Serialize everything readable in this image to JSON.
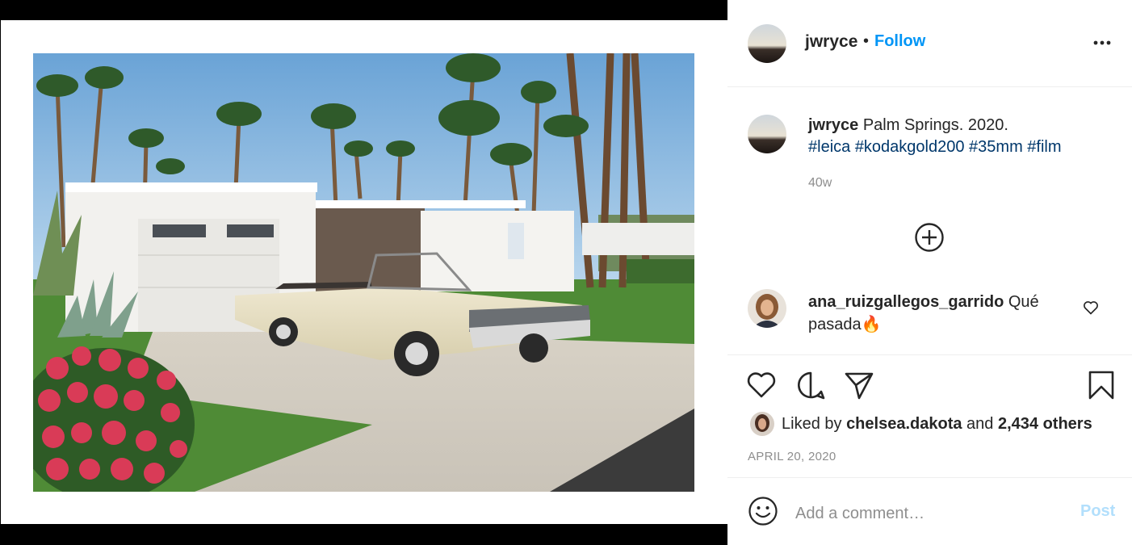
{
  "post": {
    "username": "jwryce",
    "follow_separator": "•",
    "follow_label": "Follow",
    "more_icon": "more-horizontal-icon"
  },
  "caption": {
    "username": "jwryce",
    "text": "Palm Springs. 2020.",
    "hashtags": "#leica #kodakgold200 #35mm #film",
    "age": "40w",
    "load_more_icon": "plus-circle-icon"
  },
  "comments": [
    {
      "username": "ana_ruizgallegos_garrido",
      "text": "Qué pasada",
      "emoji": "🔥",
      "like_icon": "heart-outline-icon"
    }
  ],
  "actions": {
    "like_icon": "heart-outline-icon",
    "comment_icon": "comment-bubble-icon",
    "share_icon": "paper-plane-icon",
    "save_icon": "bookmark-icon"
  },
  "likes": {
    "prefix": "Liked by",
    "user": "chelsea.dakota",
    "conjunction": "and",
    "others": "2,434 others"
  },
  "date": "APRIL 20, 2020",
  "composer": {
    "emoji_icon": "smiley-icon",
    "placeholder": "Add a comment…",
    "post_label": "Post"
  },
  "colors": {
    "accent": "#0095f6",
    "link": "#00376b",
    "muted": "#8e8e8e",
    "post_disabled": "#b2dffc"
  }
}
